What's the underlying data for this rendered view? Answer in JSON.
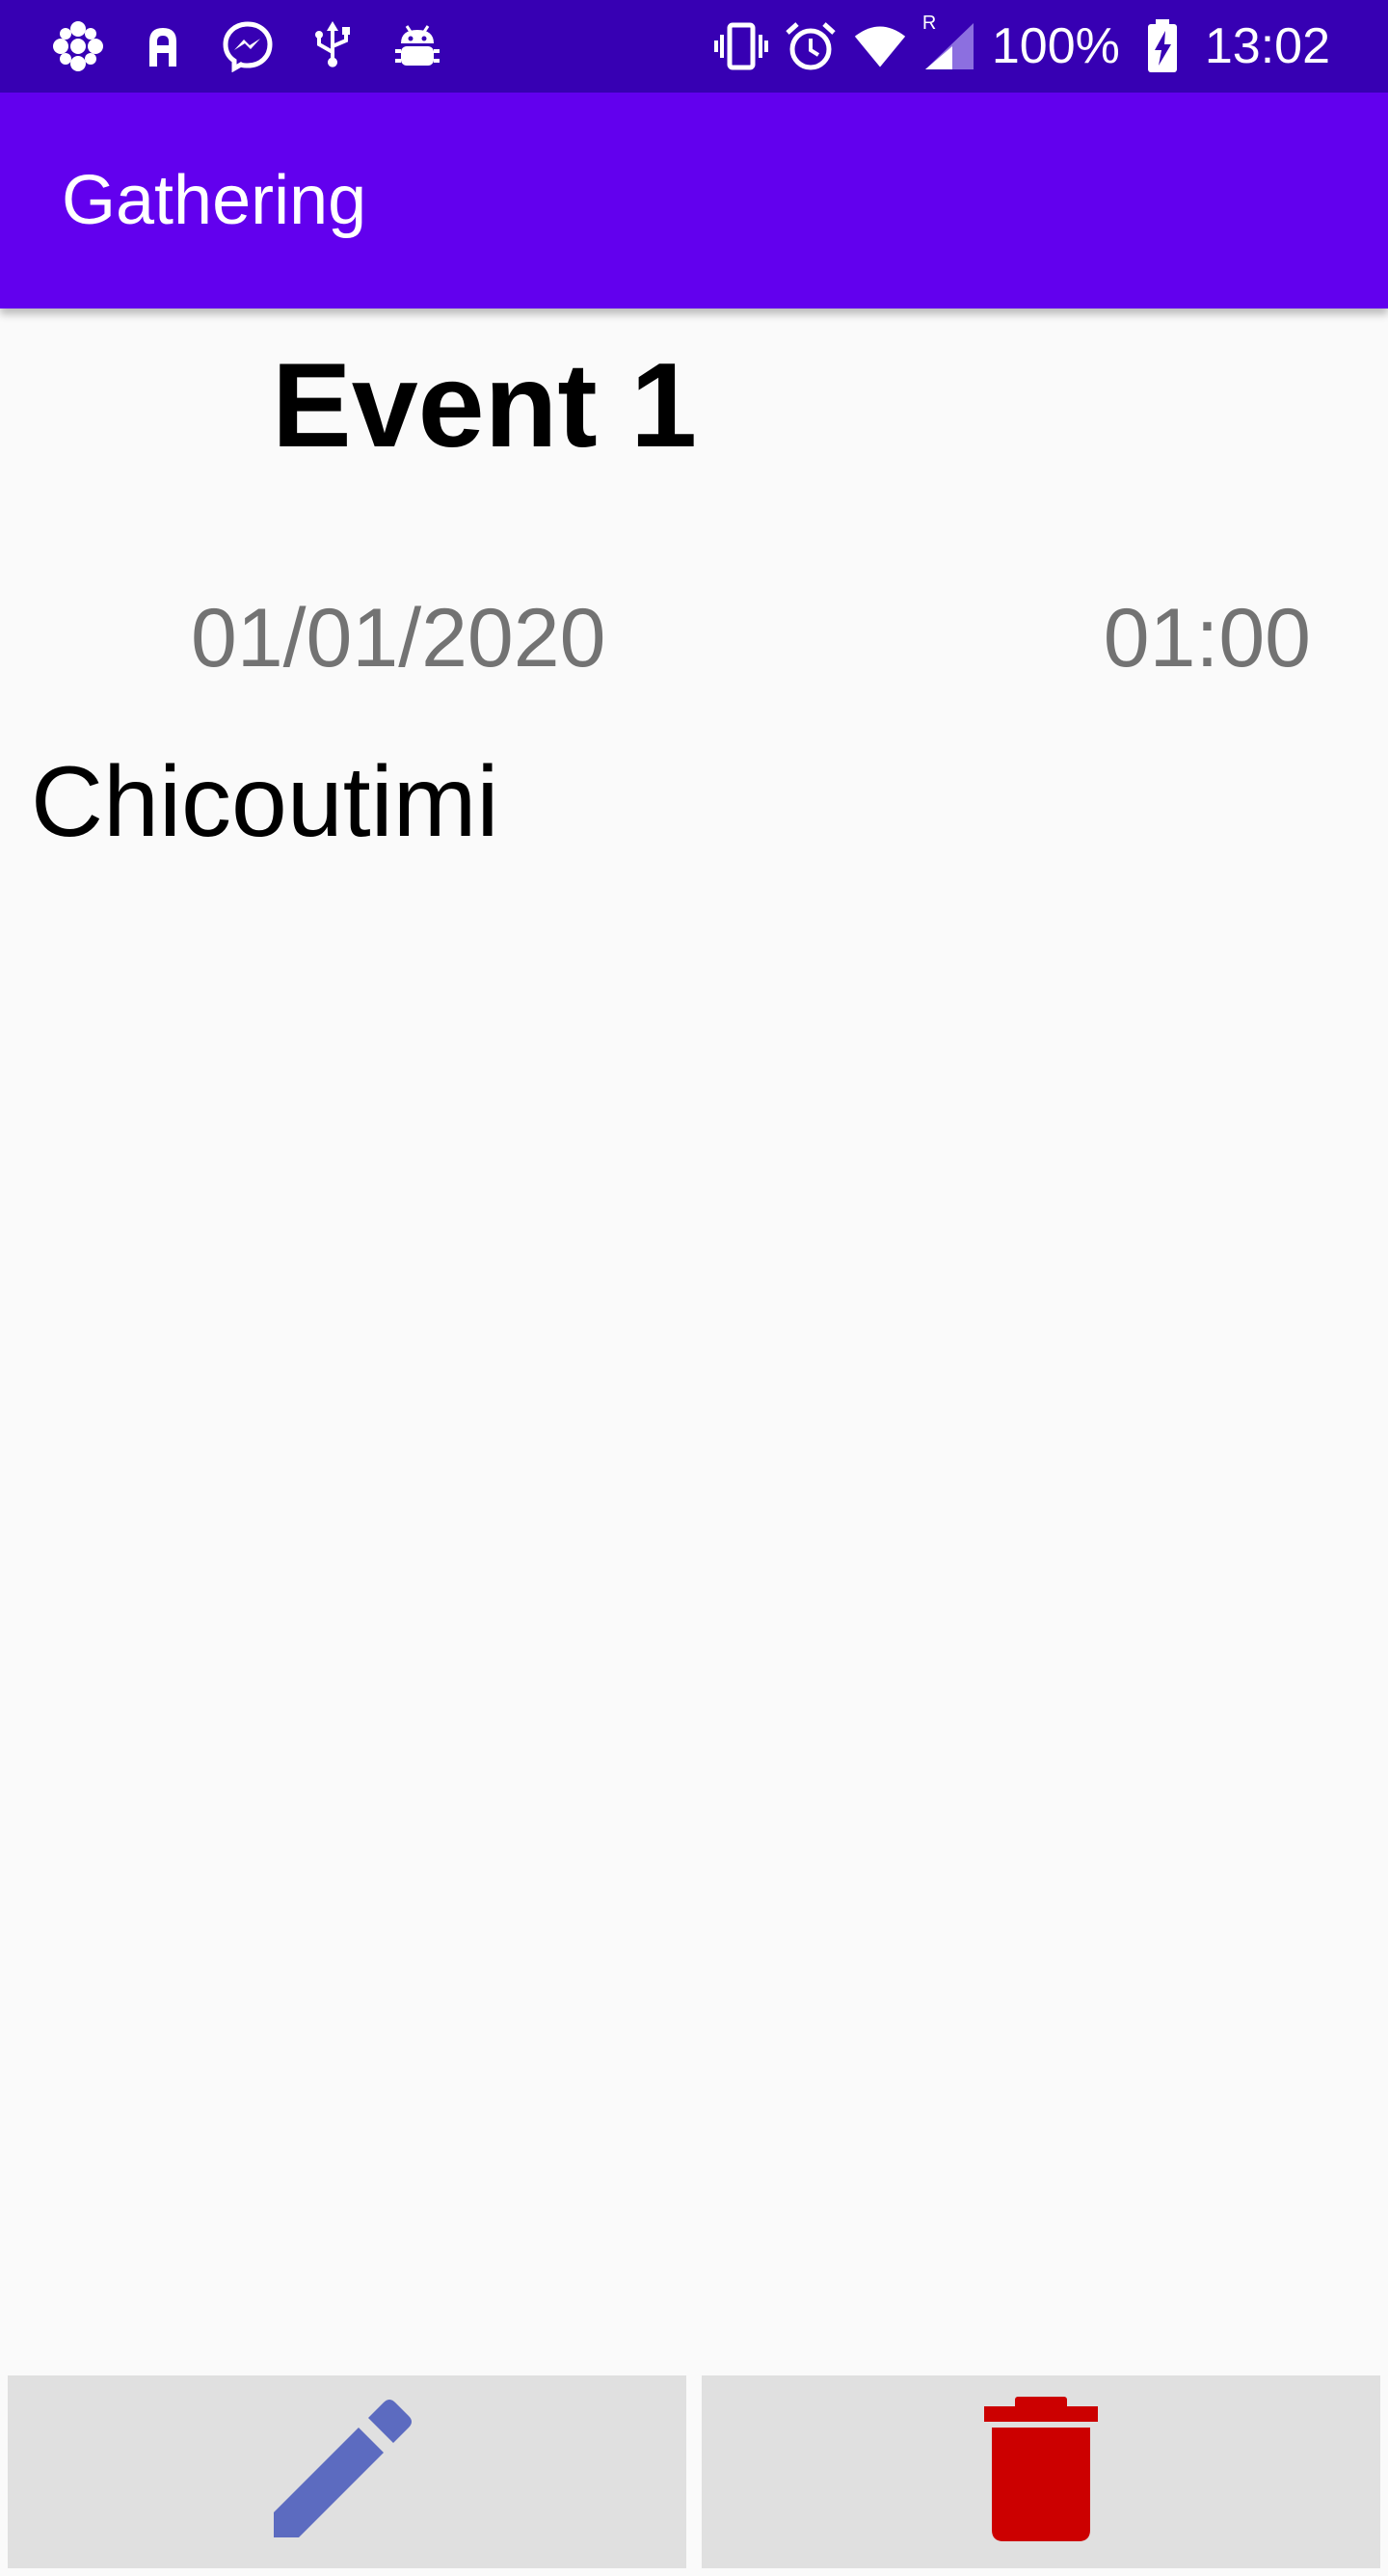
{
  "status_bar": {
    "battery": "100%",
    "time": "13:02",
    "roaming_indicator": "R",
    "left_icons": [
      "cbc-icon",
      "a-app-icon",
      "messenger-icon",
      "usb-icon",
      "android-debug-icon"
    ],
    "right_icons": [
      "vibrate-icon",
      "alarm-icon",
      "wifi-icon",
      "signal-icon",
      "battery-charging-icon"
    ]
  },
  "app_bar": {
    "title": "Gathering"
  },
  "event": {
    "name": "Event 1",
    "date": "01/01/2020",
    "time": "01:00",
    "location": "Chicoutimi"
  },
  "actions": {
    "edit_icon": "pencil-icon",
    "delete_icon": "trash-icon"
  },
  "colors": {
    "status_bar": "#3700B3",
    "app_bar": "#6200EE",
    "background": "#FAFAFA",
    "button_bg": "#E0E0E0",
    "edit_icon": "#5C6BC0",
    "delete_icon": "#CC0000",
    "secondary_text": "#737373"
  }
}
